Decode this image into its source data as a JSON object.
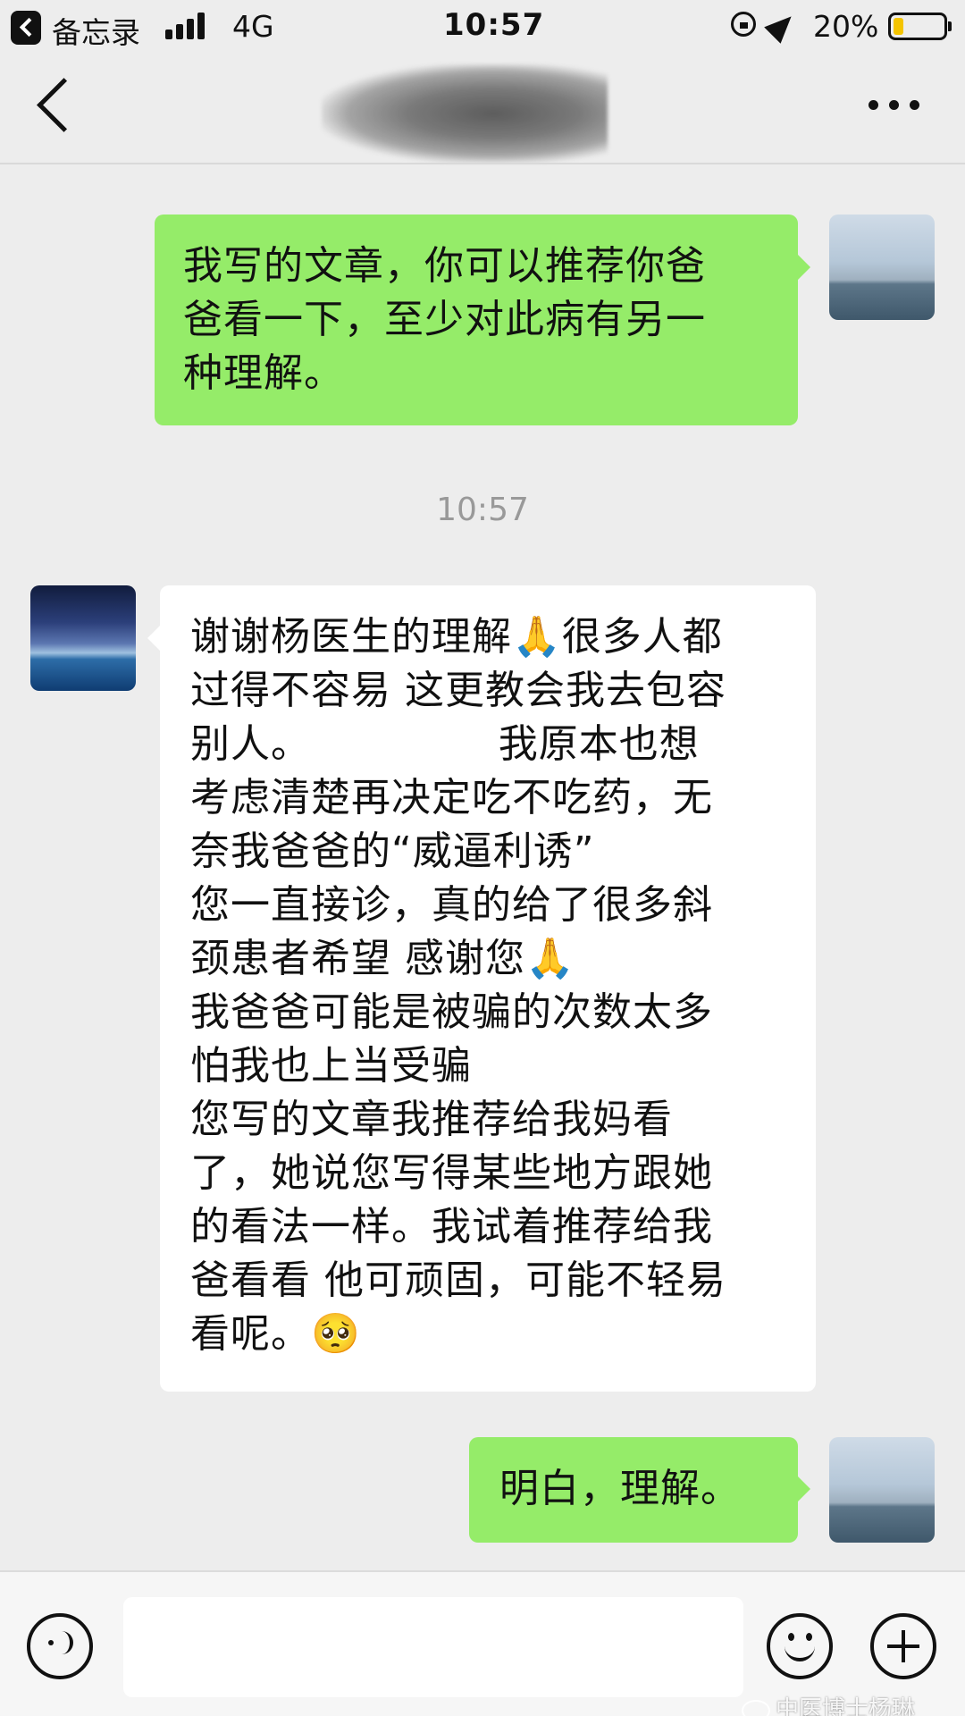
{
  "status_bar": {
    "back_app": "备忘录",
    "network": "4G",
    "time": "10:57",
    "battery": "20%",
    "battery_level": 0.2
  },
  "nav": {
    "back_icon": "chevron-left-icon",
    "more_icon": "more-dots-icon"
  },
  "messages": [
    {
      "sender": "me",
      "lines": [
        "我写的文章，你可以推荐你爸",
        "爸看一下，至少对此病有另一",
        "种理解。"
      ]
    },
    {
      "sender": "other",
      "lines": [
        "谢谢杨医生的理解🙏很多人都",
        "过得不容易 这更教会我去包容",
        "别人。              我原本也想",
        "考虑清楚再决定吃不吃药，无",
        "奈我爸爸的“威逼利诱”",
        "您一直接诊，真的给了很多斜",
        "颈患者希望 感谢您🙏",
        "我爸爸可能是被骗的次数太多",
        "怕我也上当受骗",
        "您写的文章我推荐给我妈看",
        "了，她说您写得某些地方跟她",
        "的看法一样。我试着推荐给我",
        "爸看看 他可顽固，可能不轻易",
        "看呢。🥺"
      ]
    },
    {
      "sender": "me",
      "lines": [
        "明白，理解。"
      ]
    }
  ],
  "timestamp": "10:57",
  "input_bar": {
    "placeholder": "",
    "voice_icon": "voice-icon",
    "emoji_icon": "emoji-icon",
    "plus_icon": "plus-icon"
  },
  "watermark": "中医博士杨琳",
  "colors": {
    "background": "#ededed",
    "my_bubble": "#95ec69",
    "their_bubble": "#ffffff",
    "battery": "#f4c400"
  }
}
